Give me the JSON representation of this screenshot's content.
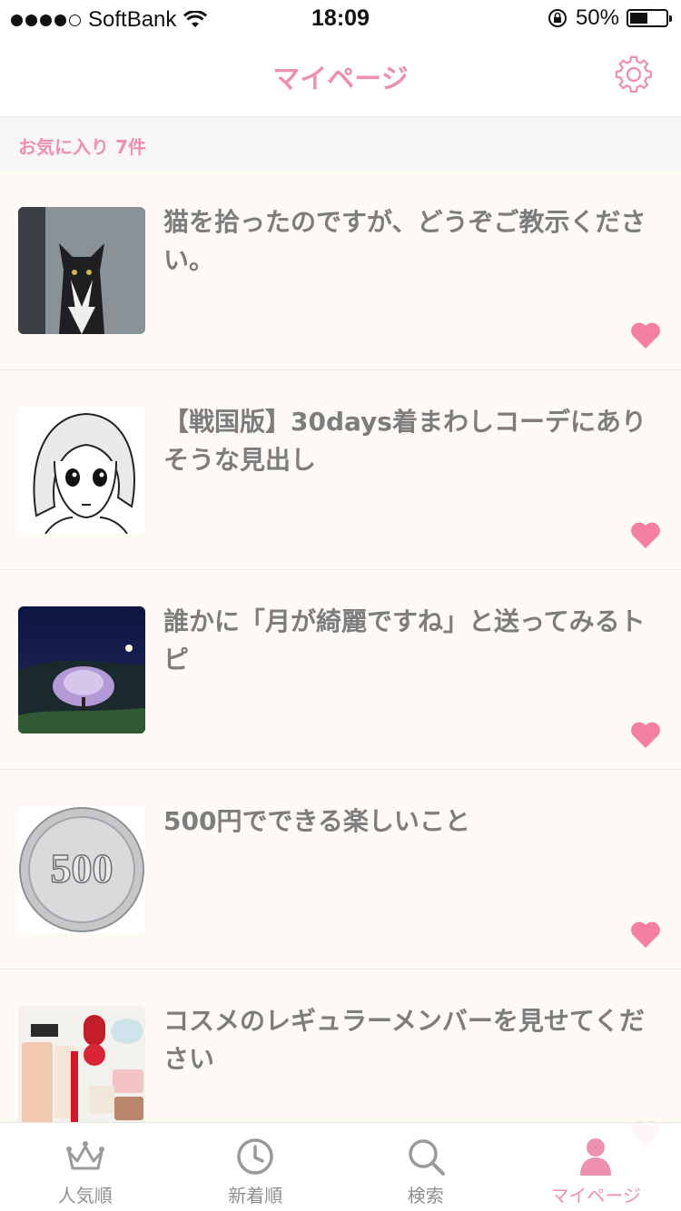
{
  "status_bar": {
    "carrier": "SoftBank",
    "time": "18:09",
    "battery": "50%",
    "battery_level": 0.5
  },
  "nav": {
    "title": "マイページ",
    "settings_icon": "gear-icon"
  },
  "section": {
    "header": "お気に入り 7件"
  },
  "colors": {
    "accent": "#ef8fb1",
    "heart": "#f47fa0",
    "text": "#7d7d7d"
  },
  "items": [
    {
      "title": "猫を拾ったのですが、どうぞご教示ください。",
      "thumb": "cat-photo",
      "favorited": true
    },
    {
      "title": "【戦国版】30days着まわしコーデにありそうな見出し",
      "thumb": "manga-girl-illustration",
      "favorited": true
    },
    {
      "title": "誰かに「月が綺麗ですね」と送ってみるトピ",
      "thumb": "night-sky-tree-photo",
      "favorited": true
    },
    {
      "title": "500円でできる楽しいこと",
      "thumb": "500-yen-coin",
      "favorited": true
    },
    {
      "title": "コスメのレギュラーメンバーを見せてください",
      "thumb": "cosmetics-photo",
      "favorited": true
    }
  ],
  "tabs": [
    {
      "label": "人気順",
      "icon": "crown-icon",
      "active": false
    },
    {
      "label": "新着順",
      "icon": "clock-icon",
      "active": false
    },
    {
      "label": "検索",
      "icon": "search-icon",
      "active": false
    },
    {
      "label": "マイページ",
      "icon": "person-icon",
      "active": true
    }
  ]
}
